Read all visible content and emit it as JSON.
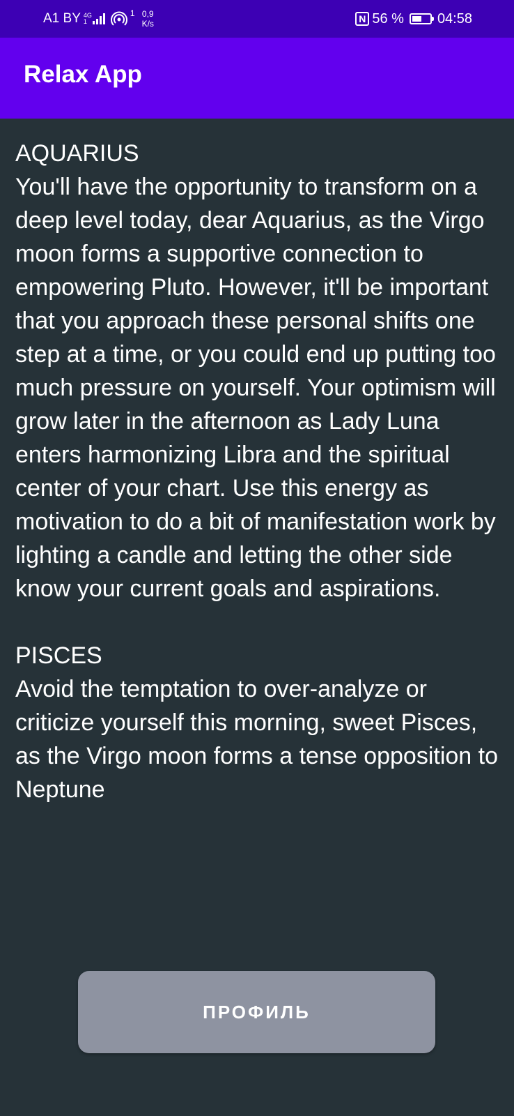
{
  "status_bar": {
    "carrier": "A1 BY",
    "network_type_top": "4G",
    "network_type_bottom": "1",
    "hotspot_count": "1",
    "speed_value": "0,9",
    "speed_unit": "K/s",
    "nfc_label": "N",
    "battery_percent": "56 %",
    "battery_level": 0.56,
    "time": "04:58",
    "icons": [
      "signal-icon",
      "hotspot-icon",
      "nfc-icon",
      "battery-charging-icon"
    ]
  },
  "app_bar": {
    "title": "Relax App",
    "color": "#6200ee",
    "status_color": "#3d00b4"
  },
  "content": {
    "text": "AQUARIUS\nYou'll have the opportunity to transform on a deep level today, dear Aquarius, as the Virgo moon forms a supportive connection to empowering Pluto. However, it'll be important that you approach these personal shifts one step at a time, or you could end up putting too much pressure on yourself. Your optimism will grow later in the afternoon as Lady Luna enters harmonizing Libra and the spiritual center of your chart. Use this energy as motivation to do a bit of manifestation work by lighting a candle and letting the other side know your current goals and aspirations.\n\nPISCES\nAvoid the temptation to over-analyze or criticize yourself this morning, sweet Pisces, as the Virgo moon forms a tense opposition to Neptune",
    "background": "#263238"
  },
  "profile_button": {
    "label": "ПРОФИЛЬ",
    "color": "#8e93a1"
  }
}
